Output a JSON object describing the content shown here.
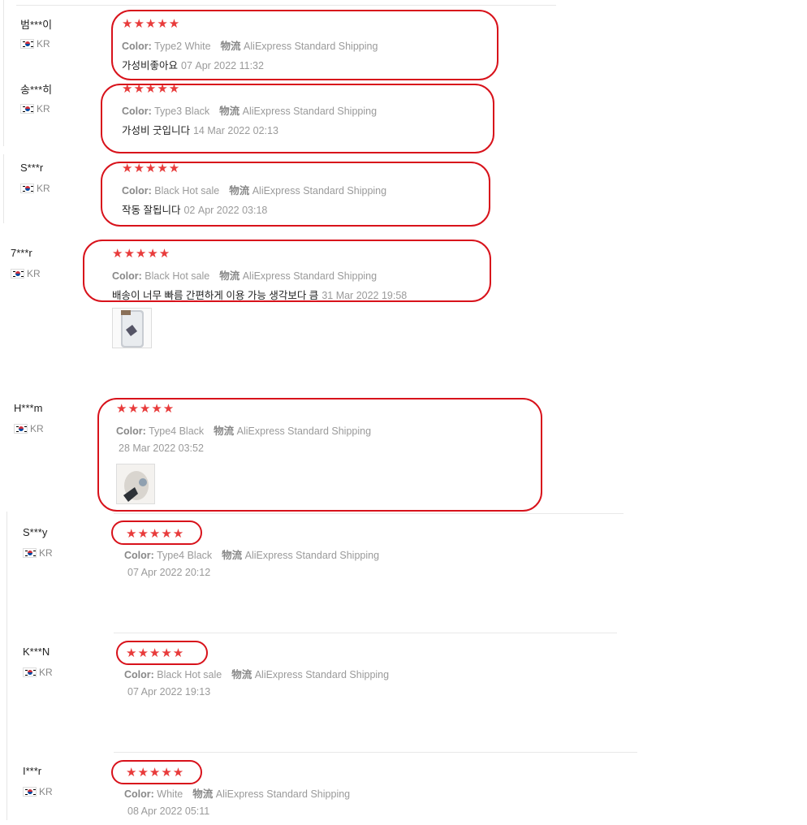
{
  "labels": {
    "color": "Color:",
    "shipping_label": "物流",
    "shipping_value": "AliExpress Standard Shipping",
    "stars": "★★★★★"
  },
  "reviews": [
    {
      "user": "범***이",
      "country": "KR",
      "color": "Type2 White",
      "text": "가성비좋아요",
      "date": "07 Apr 2022 11:32"
    },
    {
      "user": "송***히",
      "country": "KR",
      "color": "Type3 Black",
      "text": "가성비 굿입니다",
      "date": "14 Mar 2022 02:13"
    },
    {
      "user": "S***r",
      "country": "KR",
      "color": "Black Hot sale",
      "text": "작동 잘됩니다",
      "date": "02 Apr 2022 03:18"
    },
    {
      "user": "7***r",
      "country": "KR",
      "color": "Black Hot sale",
      "text": "배송이 너무 빠름 간편하게 이용 가능 생각보다 큼",
      "date": "31 Mar 2022 19:58"
    },
    {
      "user": "H***m",
      "country": "KR",
      "color": "Type4 Black",
      "text": "",
      "date": "28 Mar 2022 03:52"
    },
    {
      "user": "S***y",
      "country": "KR",
      "color": "Type4 Black",
      "text": "",
      "date": "07 Apr 2022 20:12"
    },
    {
      "user": "K***N",
      "country": "KR",
      "color": "Black Hot sale",
      "text": "",
      "date": "07 Apr 2022 19:13"
    },
    {
      "user": "I***r",
      "country": "KR",
      "color": "White",
      "text": "",
      "date": "08 Apr 2022 05:11"
    }
  ],
  "colors": {
    "star": "#e83b3b",
    "highlight": "#d8121b"
  }
}
